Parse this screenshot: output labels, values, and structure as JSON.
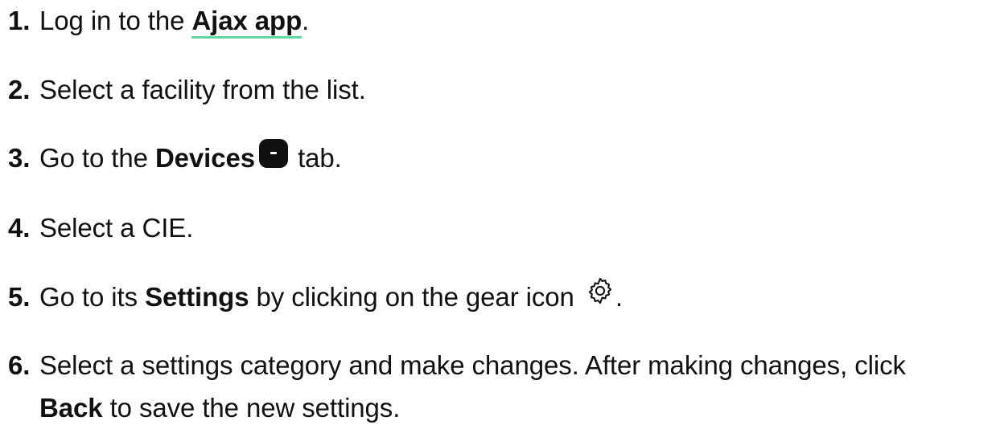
{
  "steps": [
    {
      "number": "1.",
      "before": "Log in to the ",
      "link": "Ajax app",
      "after": "."
    },
    {
      "number": "2.",
      "text": "Select a facility from the list."
    },
    {
      "number": "3.",
      "before": "Go to the ",
      "bold": "Devices",
      "icon": "devices-icon",
      "after": " tab."
    },
    {
      "number": "4.",
      "text": "Select a CIE."
    },
    {
      "number": "5.",
      "before": "Go to its ",
      "bold": "Settings",
      "middle": " by clicking on the gear icon ",
      "icon": "gear-icon",
      "after": "."
    },
    {
      "number": "6.",
      "line1": "Select a settings category and make changes. After making changes, click",
      "bold": "Back",
      "line2": " to save the new settings."
    }
  ],
  "colors": {
    "text": "#111111",
    "link_underline": "#5fd6a4"
  }
}
